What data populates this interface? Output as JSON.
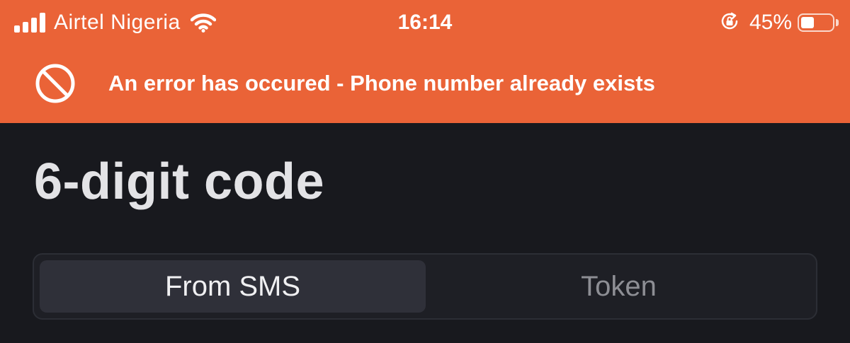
{
  "status_bar": {
    "carrier": "Airtel Nigeria",
    "time": "16:14",
    "battery_percent_label": "45%",
    "battery_level": 0.45,
    "icons": [
      "signal-icon",
      "wifi-icon",
      "rotation-lock-icon",
      "battery-icon"
    ]
  },
  "error_banner": {
    "message": "An error has occured - Phone number already exists",
    "icon": "prohibited-icon",
    "background_color": "#ea6337"
  },
  "page": {
    "title": "6-digit code"
  },
  "code_source_tabs": {
    "options": [
      "From SMS",
      "Token"
    ],
    "selected": "From SMS"
  }
}
